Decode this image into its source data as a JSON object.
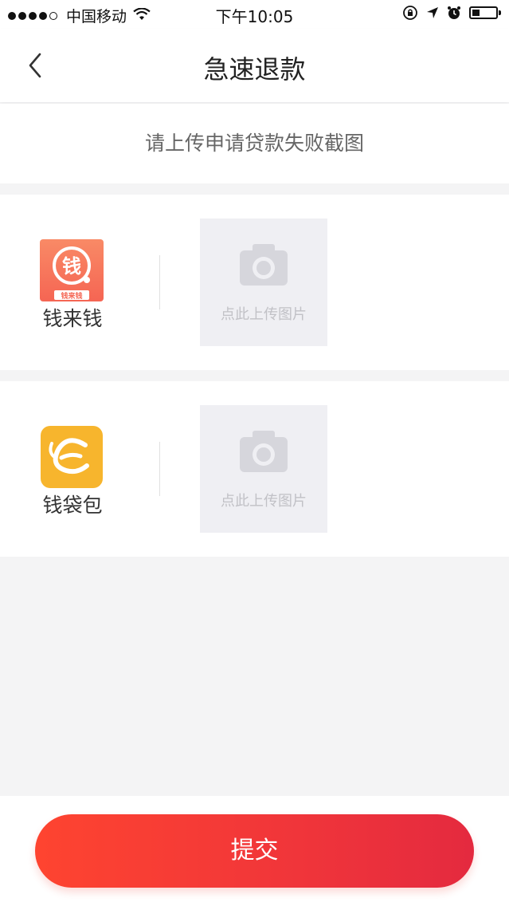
{
  "status_bar": {
    "carrier": "中国移动",
    "time": "下午10:05"
  },
  "nav": {
    "title": "急速退款"
  },
  "hint": {
    "text": "请上传申请贷款失败截图"
  },
  "apps": [
    {
      "name": "钱来钱",
      "icon_char": "钱",
      "icon_subtext": "钱来钱",
      "upload_label": "点此上传图片",
      "icon_color": "#f8705b"
    },
    {
      "name": "钱袋包",
      "upload_label": "点此上传图片",
      "icon_color": "#f7b52d"
    }
  ],
  "submit": {
    "label": "提交"
  },
  "colors": {
    "accent": "#f0353a",
    "background": "#f4f4f5",
    "upload_box": "#efeff3"
  }
}
